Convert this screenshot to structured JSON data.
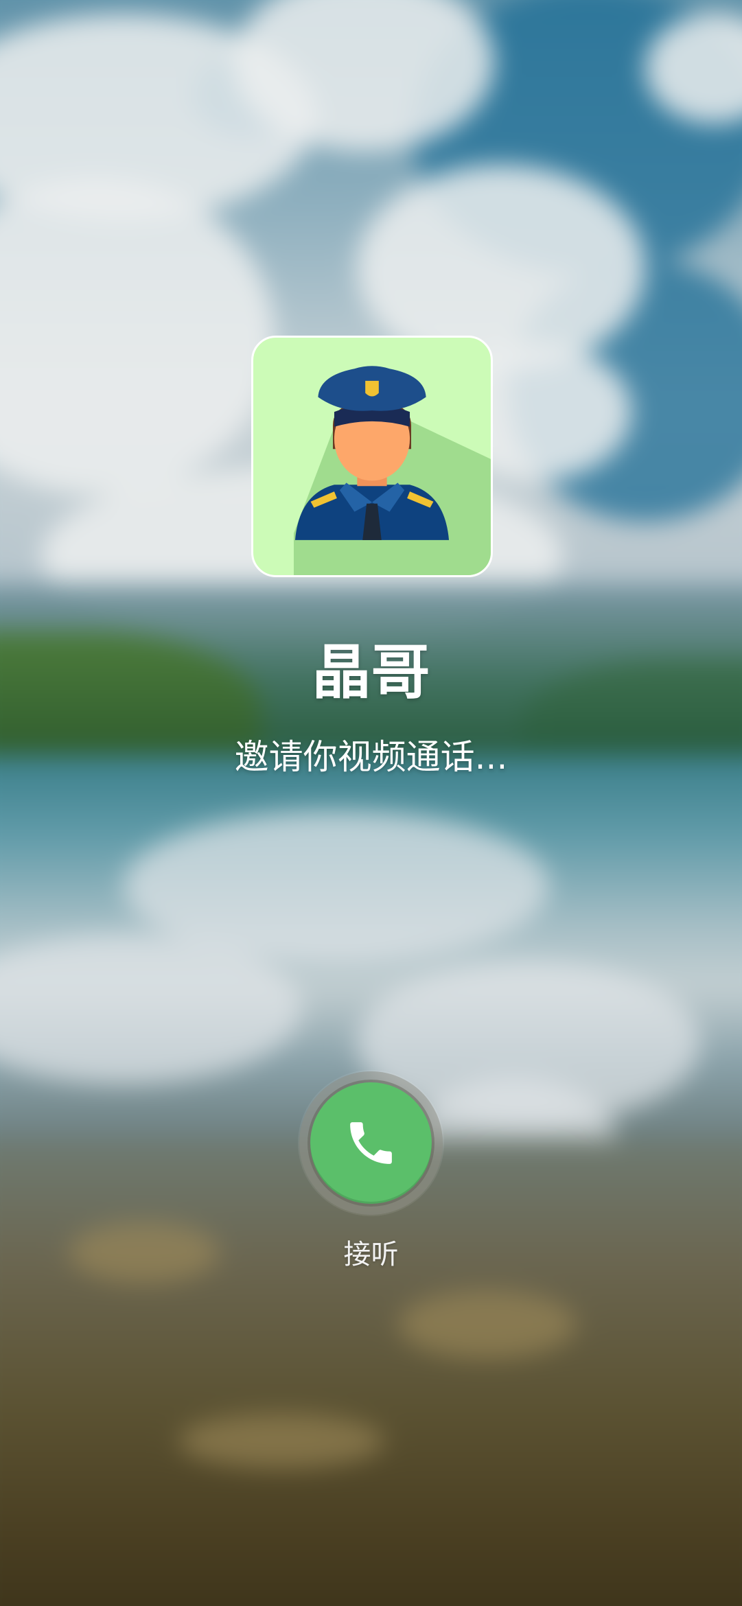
{
  "caller": {
    "name": "晶哥",
    "status": "邀请你视频通话...",
    "avatar_icon": "police-officer-avatar"
  },
  "actions": {
    "answer_label": "接听",
    "answer_icon": "phone-icon"
  },
  "colors": {
    "answer_button": "#5bbf6a",
    "avatar_background": "#ccfbb7",
    "text": "#ffffff"
  }
}
